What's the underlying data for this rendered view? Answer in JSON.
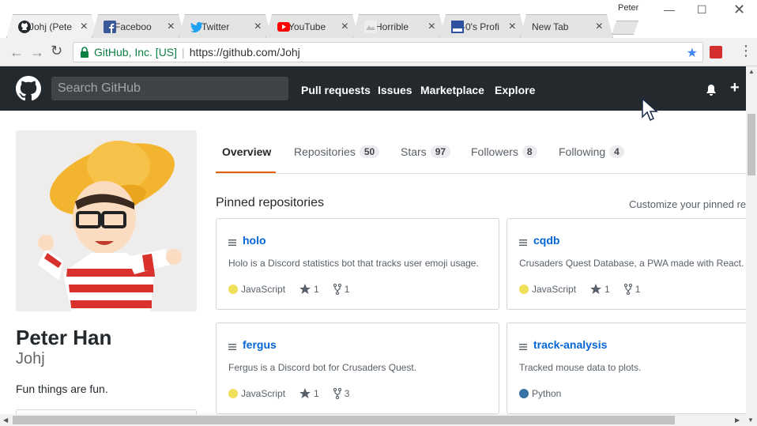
{
  "browser": {
    "tabs": [
      {
        "title": "Johj (Pete",
        "icon": "github-icon"
      },
      {
        "title": "Faceboo",
        "icon": "facebook-icon"
      },
      {
        "title": "Twitter",
        "icon": "twitter-icon"
      },
      {
        "title": "YouTube",
        "icon": "youtube-icon"
      },
      {
        "title": "Horrible",
        "icon": "horriblesubs-icon"
      },
      {
        "title": "-0's Profi",
        "icon": "mal-icon"
      },
      {
        "title": "New Tab",
        "icon": ""
      }
    ],
    "profile_name": "Peter",
    "close_glyph": "×",
    "secure_label": "GitHub, Inc. [US]",
    "url": "https://github.com/Johj",
    "accent": "#4285f4"
  },
  "github": {
    "search_placeholder": "Search GitHub",
    "nav": [
      "Pull requests",
      "Issues",
      "Marketplace",
      "Explore"
    ],
    "plus": "+"
  },
  "profile": {
    "fullname": "Peter Han",
    "username": "Johj",
    "bio": "Fun things are fun."
  },
  "tabs": [
    {
      "label": "Overview",
      "count": ""
    },
    {
      "label": "Repositories",
      "count": "50"
    },
    {
      "label": "Stars",
      "count": "97"
    },
    {
      "label": "Followers",
      "count": "8"
    },
    {
      "label": "Following",
      "count": "4"
    }
  ],
  "pinned": {
    "title": "Pinned repositories",
    "customize": "Customize your pinned re",
    "repos": [
      {
        "name": "holo",
        "desc": "Holo is a Discord statistics bot that tracks user emoji usage.",
        "lang": "JavaScript",
        "lang_color": "#f1e05a",
        "stars": "1",
        "forks": "1"
      },
      {
        "name": "cqdb",
        "desc": "Crusaders Quest Database, a PWA made with React.",
        "lang": "JavaScript",
        "lang_color": "#f1e05a",
        "stars": "1",
        "forks": "1"
      },
      {
        "name": "fergus",
        "desc": "Fergus is a Discord bot for Crusaders Quest.",
        "lang": "JavaScript",
        "lang_color": "#f1e05a",
        "stars": "1",
        "forks": "3"
      },
      {
        "name": "track-analysis",
        "desc": "Tracked mouse data to plots.",
        "lang": "Python",
        "lang_color": "#3572A5",
        "stars": "",
        "forks": ""
      }
    ]
  }
}
